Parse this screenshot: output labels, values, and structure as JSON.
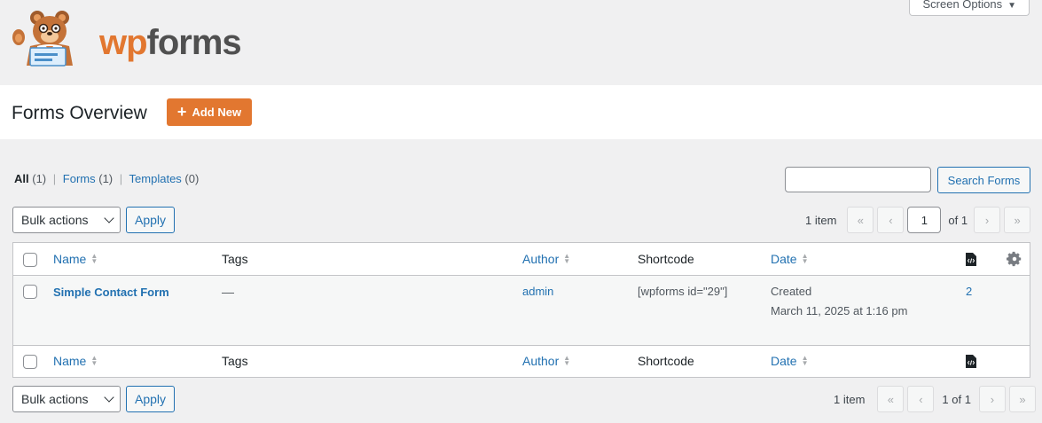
{
  "brand": {
    "part1": "wp",
    "part2": "forms"
  },
  "screen_options": {
    "label": "Screen Options",
    "arrow": "▼"
  },
  "page": {
    "title": "Forms Overview",
    "add_new_label": "Add New"
  },
  "filters": [
    {
      "label": "All",
      "count": "(1)"
    },
    {
      "label": "Forms",
      "count": "(1)"
    },
    {
      "label": "Templates",
      "count": "(0)"
    }
  ],
  "search": {
    "value": "",
    "button_label": "Search Forms"
  },
  "bulk": {
    "selected": "Bulk actions",
    "apply_label": "Apply"
  },
  "pagination_top": {
    "count": "1 item",
    "first": "«",
    "prev": "‹",
    "current": "1",
    "of": "of 1",
    "next": "›",
    "last": "»"
  },
  "pagination_bottom": {
    "count": "1 item",
    "first": "«",
    "prev": "‹",
    "page_text": "1 of 1",
    "next": "›",
    "last": "»"
  },
  "columns": {
    "name": "Name",
    "tags": "Tags",
    "author": "Author",
    "shortcode": "Shortcode",
    "date": "Date"
  },
  "rows": [
    {
      "name": "Simple Contact Form",
      "tags": "—",
      "author": "admin",
      "shortcode": "[wpforms id=\"29\"]",
      "date_status": "Created",
      "date": "March 11, 2025 at 1:16 pm",
      "entries": "2"
    }
  ],
  "colors": {
    "accent": "#e27730",
    "link": "#2271b1",
    "background": "#f0f0f1"
  },
  "icons": [
    "bear-mascot-icon",
    "plus-icon",
    "code-file-icon",
    "gear-icon",
    "sort-arrows-icon"
  ]
}
